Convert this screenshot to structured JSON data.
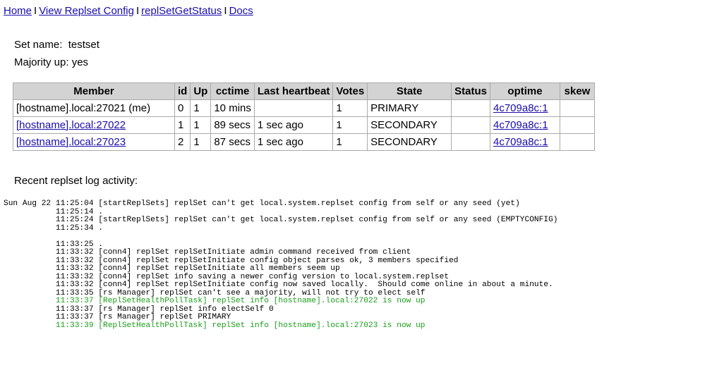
{
  "nav": {
    "home": "Home",
    "config": "View Replset Config",
    "status": "replSetGetStatus",
    "docs": "Docs",
    "separator": "I"
  },
  "set": {
    "name_label": "Set name:",
    "name_value": "testset",
    "majority_label": "Majority up:",
    "majority_value": "yes"
  },
  "members_table": {
    "headers": [
      "Member",
      "id",
      "Up",
      "cctime",
      "Last heartbeat",
      "Votes",
      "State",
      "Status",
      "optime",
      "skew"
    ],
    "rows": [
      {
        "member": "[hostname].local:27021 (me)",
        "member_link": false,
        "id": "0",
        "up": "1",
        "cctime": "10 mins",
        "heartbeat": "",
        "votes": "1",
        "state": "PRIMARY",
        "status": "",
        "optime": "4c709a8c:1",
        "skew": ""
      },
      {
        "member": "[hostname].local:27022",
        "member_link": true,
        "id": "1",
        "up": "1",
        "cctime": "89 secs",
        "heartbeat": "1 sec ago",
        "votes": "1",
        "state": "SECONDARY",
        "status": "",
        "optime": "4c709a8c:1",
        "skew": ""
      },
      {
        "member": "[hostname].local:27023",
        "member_link": true,
        "id": "2",
        "up": "1",
        "cctime": "87 secs",
        "heartbeat": "1 sec ago",
        "votes": "1",
        "state": "SECONDARY",
        "status": "",
        "optime": "4c709a8c:1",
        "skew": ""
      }
    ]
  },
  "log": {
    "title": "Recent replset log activity:",
    "colors": {
      "highlight": "#1a9e1a"
    },
    "lines": [
      {
        "text": "Sun Aug 22 11:25:04 [startReplSets] replSet can't get local.system.replset config from self or any seed (yet)",
        "green": false
      },
      {
        "text": "           11:25:14 .",
        "green": false
      },
      {
        "text": "           11:25:24 [startReplSets] replSet can't get local.system.replset config from self or any seed (EMPTYCONFIG)",
        "green": false
      },
      {
        "text": "           11:25:34 .",
        "green": false
      },
      {
        "text": "",
        "green": false
      },
      {
        "text": "           11:33:25 .",
        "green": false
      },
      {
        "text": "           11:33:32 [conn4] replSet replSetInitiate admin command received from client",
        "green": false
      },
      {
        "text": "           11:33:32 [conn4] replSet replSetInitiate config object parses ok, 3 members specified",
        "green": false
      },
      {
        "text": "           11:33:32 [conn4] replSet replSetInitiate all members seem up",
        "green": false
      },
      {
        "text": "           11:33:32 [conn4] replSet info saving a newer config version to local.system.replset",
        "green": false
      },
      {
        "text": "           11:33:32 [conn4] replSet replSetInitiate config now saved locally.  Should come online in about a minute.",
        "green": false
      },
      {
        "text": "           11:33:35 [rs Manager] replSet can't see a majority, will not try to elect self",
        "green": false
      },
      {
        "text": "           11:33:37 [ReplSetHealthPollTask] replSet info [hostname].local:27022 is now up",
        "green": true
      },
      {
        "text": "           11:33:37 [rs Manager] replSet info electSelf 0",
        "green": false
      },
      {
        "text": "           11:33:37 [rs Manager] replSet PRIMARY",
        "green": false
      },
      {
        "text": "           11:33:39 [ReplSetHealthPollTask] replSet info [hostname].local:27023 is now up",
        "green": true
      }
    ]
  }
}
